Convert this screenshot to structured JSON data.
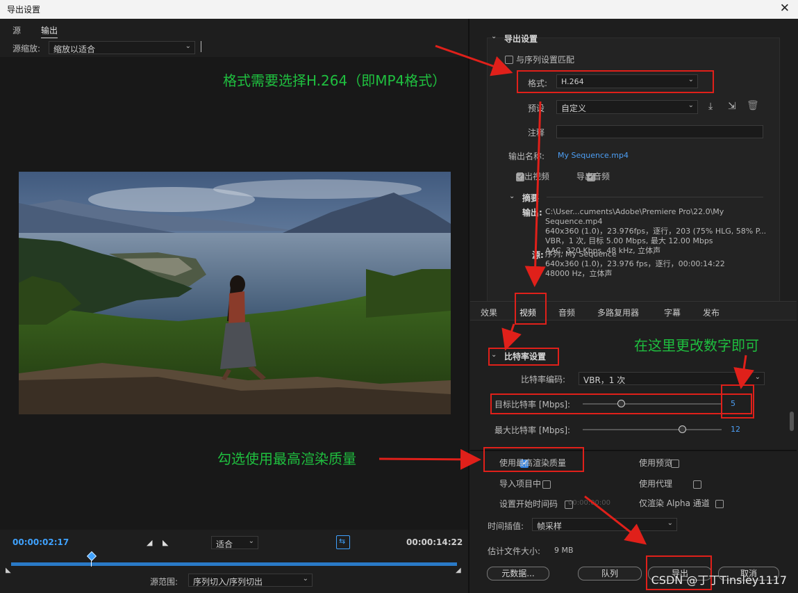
{
  "window": {
    "title": "导出设置",
    "close_icon": "close-icon"
  },
  "left": {
    "tabs": [
      {
        "label": "源"
      },
      {
        "label": "输出"
      }
    ],
    "source_zoom_label": "源缩放:",
    "source_zoom_value": "缩放以适合",
    "timeline": {
      "current_time": "00:00:02:17",
      "fit_value": "适合",
      "end_time": "00:00:14:22",
      "playhead_fraction": 0.18
    },
    "source_range_label": "源范围:",
    "source_range_value": "序列切入/序列切出"
  },
  "right": {
    "export_settings_title": "导出设置",
    "match_sequence_label": "与序列设置匹配",
    "format_label": "格式:",
    "format_value": "H.264",
    "preset_label": "预设",
    "preset_value": "自定义",
    "comment_label": "注释",
    "output_name_label": "输出名称:",
    "output_name_value": "My Sequence.mp4",
    "export_video_label": "导出视频",
    "export_audio_label": "导出音频",
    "summary_title": "摘要",
    "summary_output_label": "输出:",
    "summary_output_lines": [
      "C:\\User...cuments\\Adobe\\Premiere Pro\\22.0\\My Sequence.mp4",
      "640x360 (1.0)，23.976fps，逐行，203 (75% HLG, 58% P...",
      "VBR，1 次, 目标 5.00 Mbps, 最大 12.00 Mbps",
      "AAC, 320 Kbps, 48 kHz, 立体声"
    ],
    "summary_source_label": "源:",
    "summary_source_lines": [
      "序列, My Sequence",
      "640x360 (1.0)，23.976 fps，逐行，00:00:14:22",
      "48000 Hz，立体声"
    ],
    "tabs": [
      "效果",
      "视频",
      "音频",
      "多路复用器",
      "字幕",
      "发布"
    ],
    "bitrate_section_title": "比特率设置",
    "bitrate_encoding_label": "比特率编码:",
    "bitrate_encoding_value": "VBR，1 次",
    "target_bitrate_label": "目标比特率 [Mbps]:",
    "target_bitrate_value": "5",
    "target_bitrate_fraction": 0.28,
    "max_bitrate_label": "最大比特率 [Mbps]:",
    "max_bitrate_value": "12",
    "max_bitrate_fraction": 0.72,
    "use_max_render_label": "使用最高渲染质量",
    "use_previews_label": "使用预览",
    "import_project_label": "导入项目中",
    "use_proxies_label": "使用代理",
    "set_start_tc_label": "设置开始时间码",
    "start_tc_value": "00:00:00:00",
    "render_alpha_label": "仅渲染 Alpha 通道",
    "time_interp_label": "时间插值:",
    "time_interp_value": "帧采样",
    "est_size_label": "估计文件大小:",
    "est_size_value": "9 MB",
    "metadata_button": "元数据...",
    "queue_button": "队列",
    "export_button": "导出",
    "cancel_button": "取消"
  },
  "annotations": {
    "format_note": "格式需要选择H.264（即MP4格式）",
    "bitrate_note": "在这里更改数字即可",
    "render_note": "勾选使用最高渲染质量",
    "color": "#1fbf3f",
    "box_color": "#e0201a"
  },
  "watermark": "CSDN @丁丁Tinsley1117"
}
